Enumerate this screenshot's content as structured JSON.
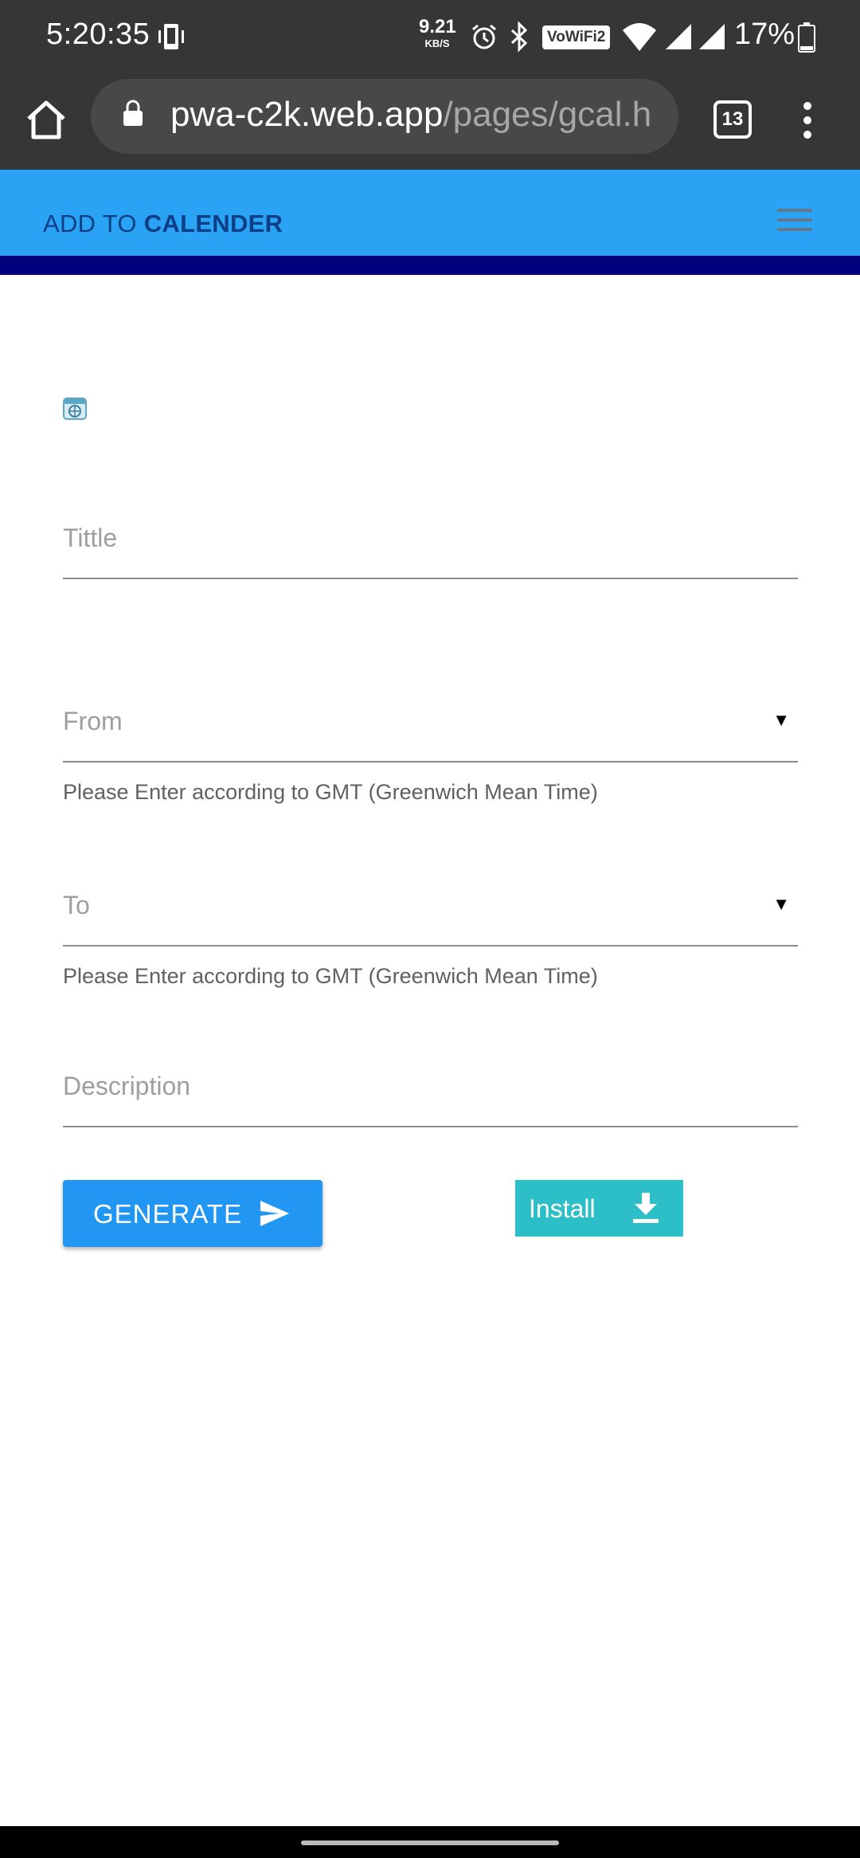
{
  "status_bar": {
    "time": "5:20:35",
    "net_speed_value": "9.21",
    "net_speed_unit": "KB/S",
    "wifi_label": "VoWiFi2",
    "battery": "17%"
  },
  "browser": {
    "url_host": "pwa-c2k.web.app",
    "url_path": "/pages/gcal.h",
    "tab_count": "13"
  },
  "header": {
    "title_prefix": "ADD TO ",
    "title_bold": "CALENDER"
  },
  "form": {
    "title_placeholder": "Tittle",
    "from_placeholder": "From",
    "from_helper": "Please Enter according to GMT (Greenwich Mean Time)",
    "to_placeholder": "To",
    "to_helper": "Please Enter according to GMT (Greenwich Mean Time)",
    "description_placeholder": "Description",
    "dropdown_arrow": "▼",
    "generate_label": "GENERATE",
    "install_label": "Install"
  },
  "colors": {
    "header_bg": "#2aa3f5",
    "header_text": "#0d3e86",
    "accent_strip": "#00007d",
    "generate_bg": "#2196f3",
    "install_bg": "#2dbfc7",
    "chrome_bg": "#353638"
  },
  "icons": {
    "status": [
      "phone-vibrate-icon",
      "alarm-icon",
      "bluetooth-icon",
      "wifi-icon",
      "signal-icon",
      "battery-icon"
    ],
    "toolbar": [
      "home-icon",
      "lock-icon",
      "overflow-menu-icon"
    ],
    "app": [
      "hamburger-icon",
      "calendar-icon",
      "send-icon",
      "download-icon"
    ]
  }
}
